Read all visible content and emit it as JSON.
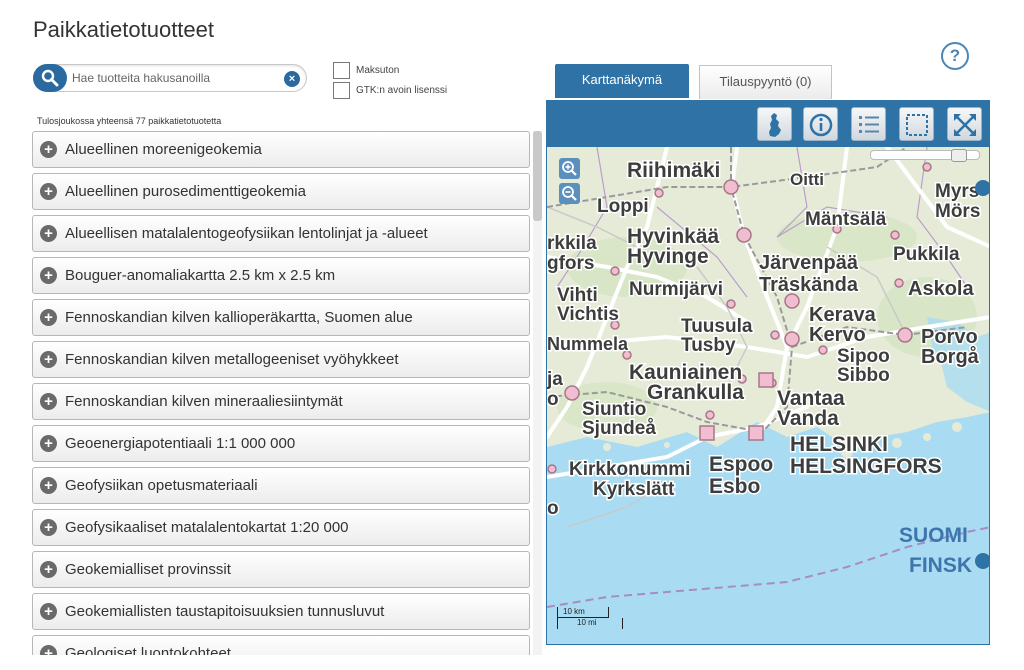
{
  "header": {
    "title": "Paikkatietotuotteet",
    "help_label": "?"
  },
  "search": {
    "placeholder": "Hae tuotteita hakusanoilla",
    "value": "",
    "clear_label": "×"
  },
  "filters": [
    {
      "label": "Maksuton",
      "checked": false
    },
    {
      "label": "GTK:n avoin lisenssi",
      "checked": false
    }
  ],
  "results": {
    "summary": "Tulosjoukossa yhteensä 77 paikkatietotuotetta",
    "items": [
      "Alueellinen moreenigeokemia",
      "Alueellinen purosedimenttigeokemia",
      "Alueellisen matalalentogeofysiikan lentolinjat ja -alueet",
      "Bouguer-anomaliakartta 2.5 km x 2.5 km",
      "Fennoskandian kilven kallioperäkartta, Suomen alue",
      "Fennoskandian kilven metallogeeniset vyöhykkeet",
      "Fennoskandian kilven mineraaliesiintymät",
      "Geoenergiapotentiaali 1:1 000 000",
      "Geofysiikan opetusmateriaali",
      "Geofysikaaliset matalalentokartat 1:20 000",
      "Geokemialliset provinssit",
      "Geokemiallisten taustapitoisuuksien tunnusluvut",
      "Geologiset luontokohteet"
    ]
  },
  "tabs": {
    "map": "Karttanäkymä",
    "order": "Tilauspyyntö (0)"
  },
  "map": {
    "toolbar_icons": [
      "finland-map-icon",
      "info-icon",
      "list-icon",
      "select-area-icon",
      "fullscreen-icon"
    ],
    "scale": {
      "km": "10 km",
      "mi": "10 mi"
    },
    "colors": {
      "land": "#e6ebd8",
      "sea": "#a9dcf2",
      "road": "#ffffff",
      "toolbar": "#2f72a6"
    },
    "places": {
      "riihimaki": "Riihimäki",
      "oitti": "Oitti",
      "loppi": "Loppi",
      "mantsala": "Mäntsälä",
      "myrs": "Myrs",
      "mors": "Mörs",
      "rkkila": "rkkila",
      "gfors": "gfors",
      "hyvinkaa": "Hyvinkää",
      "hyvinge": "Hyvinge",
      "pukkila": "Pukkila",
      "jarvenpaa": "Järvenpää",
      "traskanda": "Träskända",
      "vihti": "Vihti",
      "vichtis": "Vichtis",
      "nurmijarvi": "Nurmijärvi",
      "askola": "Askola",
      "kerava": "Kerava",
      "kervo": "Kervo",
      "tuusula": "Tuusula",
      "tusby": "Tusby",
      "porvo": "Porvo",
      "borga": "Borgå",
      "nummela": "Nummela",
      "sipoo": "Sipoo",
      "sibbo": "Sibbo",
      "ja": "ja",
      "kauniainen": "Kauniainen",
      "grankulla": "Grankulla",
      "o1": "o",
      "siuntio": "Siuntio",
      "sjundea": "Sjundeå",
      "vantaa": "Vantaa",
      "vanda": "Vanda",
      "helsinki": "HELSINKI",
      "helsingfors": "HELSINGFORS",
      "kirkkonummi": "Kirkkonummi",
      "kyrkslatt": "Kyrkslätt",
      "espoo": "Espoo",
      "esbo": "Esbo",
      "o2": "o",
      "suomi": "SUOMI",
      "finsk": "FINSK"
    }
  }
}
